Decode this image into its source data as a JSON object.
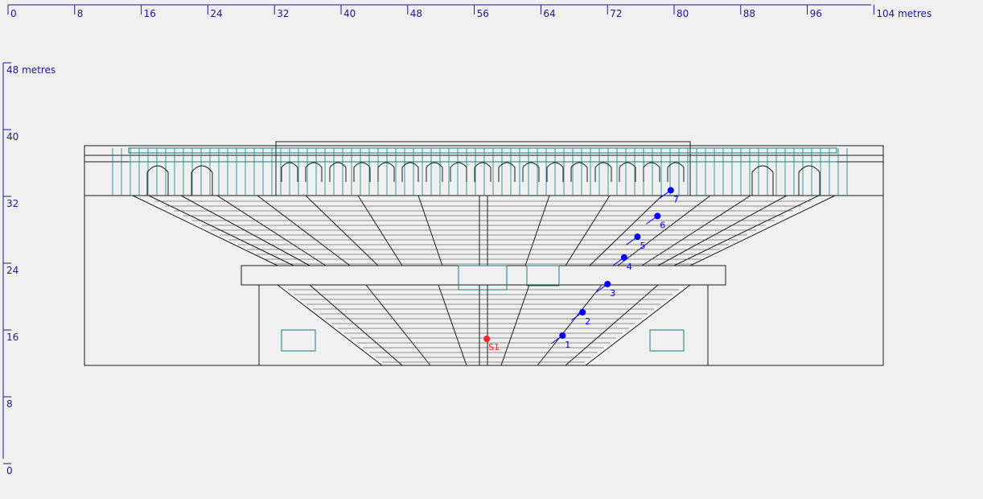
{
  "rulers": {
    "horizontal": {
      "ticks": [
        "0",
        "8",
        "16",
        "24",
        "32",
        "40",
        "48",
        "56",
        "64",
        "72",
        "80",
        "88",
        "96",
        "104 metres"
      ]
    },
    "vertical": {
      "ticks": [
        "48 metres",
        "40",
        "32",
        "24",
        "16",
        "8",
        "0"
      ]
    }
  },
  "colors": {
    "ruler": "#1a1a8c",
    "structure": "#1a1a1a",
    "teal": "#0f8080",
    "listener": "#0000ff",
    "source": "#ff2020",
    "background": "#f0f0f0"
  },
  "points": {
    "listeners": [
      {
        "label": "1",
        "x": 66.6,
        "y": 16.4
      },
      {
        "label": "2",
        "x": 69.0,
        "y": 19.2
      },
      {
        "label": "3",
        "x": 72.0,
        "y": 22.6
      },
      {
        "label": "4",
        "x": 74.0,
        "y": 25.8
      },
      {
        "label": "5",
        "x": 75.6,
        "y": 28.3
      },
      {
        "label": "6",
        "x": 78.0,
        "y": 30.8
      },
      {
        "label": "7",
        "x": 79.6,
        "y": 33.9
      }
    ],
    "sources": [
      {
        "label": "S1",
        "x": 57.5,
        "y": 16.0
      }
    ]
  }
}
